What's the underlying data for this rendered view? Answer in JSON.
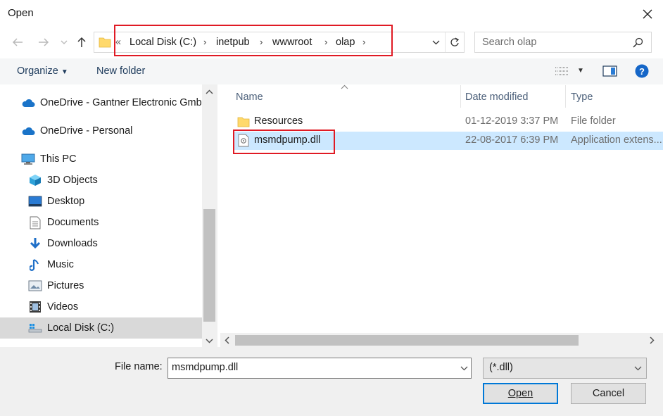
{
  "window": {
    "title": "Open"
  },
  "address": {
    "overflow": "«",
    "crumbs": [
      "Local Disk (C:)",
      "inetpub",
      "wwwroot",
      "olap"
    ]
  },
  "search": {
    "placeholder": "Search olap"
  },
  "toolbar": {
    "organize": "Organize",
    "new_folder": "New folder"
  },
  "nav": {
    "items": [
      {
        "label": "OneDrive - Gantner Electronic Gmb",
        "icon": "cloud-icon"
      },
      {
        "label": "OneDrive - Personal",
        "icon": "cloud-icon"
      },
      {
        "label": "This PC",
        "icon": "computer-icon"
      },
      {
        "label": "3D Objects",
        "icon": "cube-icon"
      },
      {
        "label": "Desktop",
        "icon": "desktop-icon"
      },
      {
        "label": "Documents",
        "icon": "document-icon"
      },
      {
        "label": "Downloads",
        "icon": "download-icon"
      },
      {
        "label": "Music",
        "icon": "music-icon"
      },
      {
        "label": "Pictures",
        "icon": "pictures-icon"
      },
      {
        "label": "Videos",
        "icon": "video-icon"
      },
      {
        "label": "Local Disk (C:)",
        "icon": "drive-icon"
      }
    ]
  },
  "files": {
    "columns": [
      "Name",
      "Date modified",
      "Type"
    ],
    "rows": [
      {
        "name": "Resources",
        "date": "01-12-2019 3:37 PM",
        "type": "File folder",
        "icon": "folder-icon"
      },
      {
        "name": "msmdpump.dll",
        "date": "22-08-2017 6:39 PM",
        "type": "Application extens...",
        "icon": "dll-file-icon"
      }
    ]
  },
  "bottom": {
    "file_name_label": "File name:",
    "file_name_value": "msmdpump.dll",
    "file_type": "(*.dll)",
    "open_label": "Open",
    "cancel_label": "Cancel"
  },
  "colors": {
    "highlight_red": "#e01a24",
    "selection_blue": "#cce8ff",
    "accent": "#0078d7"
  }
}
